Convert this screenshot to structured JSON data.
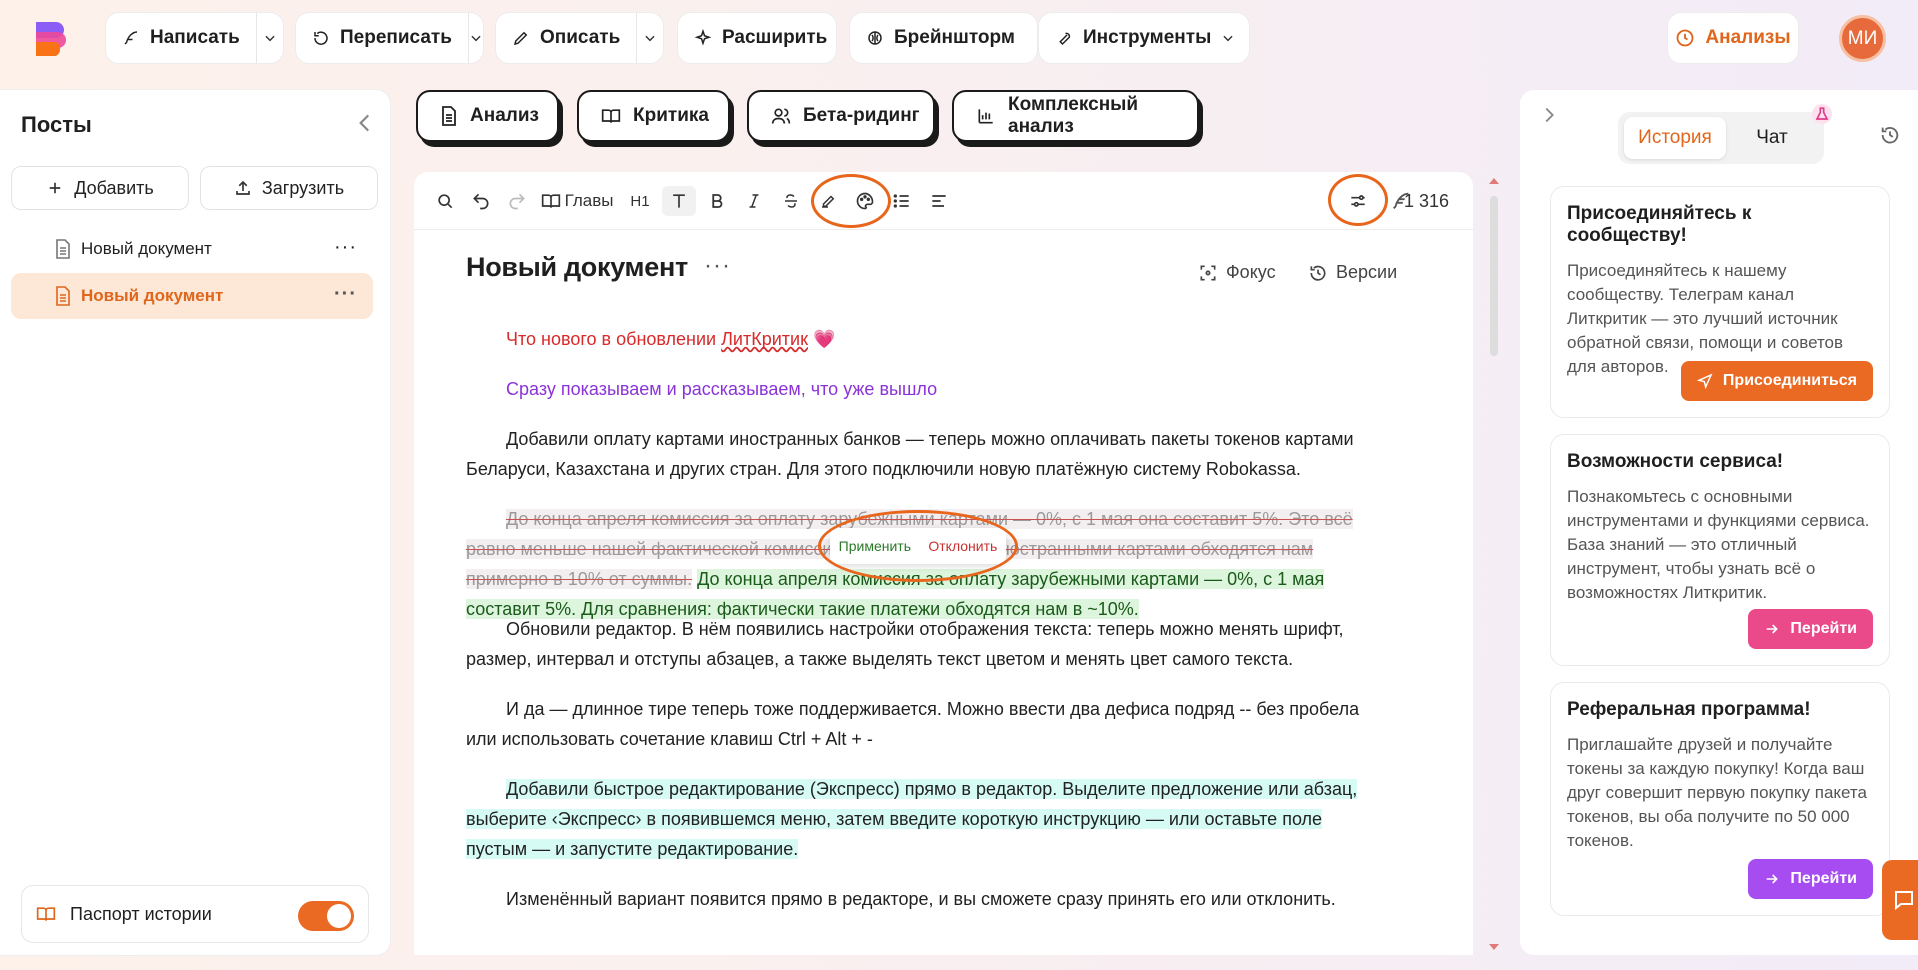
{
  "toolbar": {
    "write": "Написать",
    "rewrite": "Переписать",
    "describe": "Описать",
    "expand": "Расширить",
    "brainstorm": "Брейншторм",
    "tools": "Инструменты",
    "analyses": "Анализы",
    "avatar_initials": "МИ"
  },
  "sidebar": {
    "title": "Посты",
    "add_label": "Добавить",
    "upload_label": "Загрузить",
    "docs": [
      "Новый документ",
      "Новый документ"
    ],
    "passport_label": "Паспорт истории"
  },
  "analysis_tabs": [
    "Анализ",
    "Критика",
    "Бета-ридинг",
    "Комплексный анализ"
  ],
  "editor": {
    "chapters_label": "Главы",
    "heading_label": "H1",
    "word_count": "1 316",
    "doc_title": "Новый документ",
    "focus_label": "Фокус",
    "versions_label": "Версии",
    "p1_a": "Что нового в обновлении ",
    "p1_link": "ЛитКритик",
    "p1_emoji": "💗",
    "p2": "Сразу показываем и рассказываем, что уже вышло",
    "p3": "Добавили оплату картами иностранных банков — теперь можно оплачивать пакеты токенов картами Беларуси, Казахстана и других стран. Для этого подключили новую платёжную систему Robokassa.",
    "p4_deleted": "До конца апреля комиссия за оплату зарубежными картами — 0%, с 1 мая она составит 5%. Это всё равно меньше нашей фактической комиссии: сейчас платежи иностранными картами обходятся нам примерно в 10% от суммы.",
    "p4_added": "До конца апреля комиссия за оплату зарубежными картами — 0%, с 1 мая составит 5%. Для сравнения: фактически такие платежи обходятся нам в ~10%.",
    "apply_label": "Применить",
    "reject_label": "Отклонить",
    "p5": "Обновили редактор. В нём появились настройки отображения текста: теперь можно менять шрифт, размер, интервал и отступы абзацев, а также выделять текст цветом и менять цвет самого текста.",
    "p6": "И да — длинное тире теперь тоже поддерживается. Можно ввести два дефиса подряд -- без пробела или использовать сочетание клавиш Ctrl + Alt + -",
    "p7": "Добавили быстрое редактирование (Экспресс) прямо в редактор. Выделите предложение или абзац, выберите ‹Экспресс› в появившемся меню, затем введите короткую инструкцию — или оставьте поле пустым — и запустите редактирование.",
    "p8": "Изменённый вариант появится прямо в редакторе, и вы сможете сразу принять его или отклонить."
  },
  "right_panel": {
    "tab_history": "История",
    "tab_chat": "Чат",
    "cards": [
      {
        "title": "Присоединяйтесь к сообществу!",
        "text": "Присоединяйтесь к нашему сообществу. Телеграм канал Литкритик — это лучший источник обратной связи, помощи и советов для авторов.",
        "button": "Присоединиться",
        "color": "#ea6a24"
      },
      {
        "title": "Возможности сервиса!",
        "text": "Познакомьтесь с основными инструментами и функциями сервиса. База знаний — это отличный инструмент, чтобы узнать всё о возможностях Литкритик.",
        "button": "Перейти",
        "color": "#ea4a8a"
      },
      {
        "title": "Реферальная программа!",
        "text": "Приглашайте друзей и получайте токены за каждую покупку! Когда ваш друг совершит первую покупку пакета токенов, вы оба получите по 50 000 токенов.",
        "button": "Перейти",
        "color": "#a64cf0"
      }
    ]
  },
  "colors": {
    "accent": "#ea6a24",
    "accent_text": "#e0661b"
  }
}
